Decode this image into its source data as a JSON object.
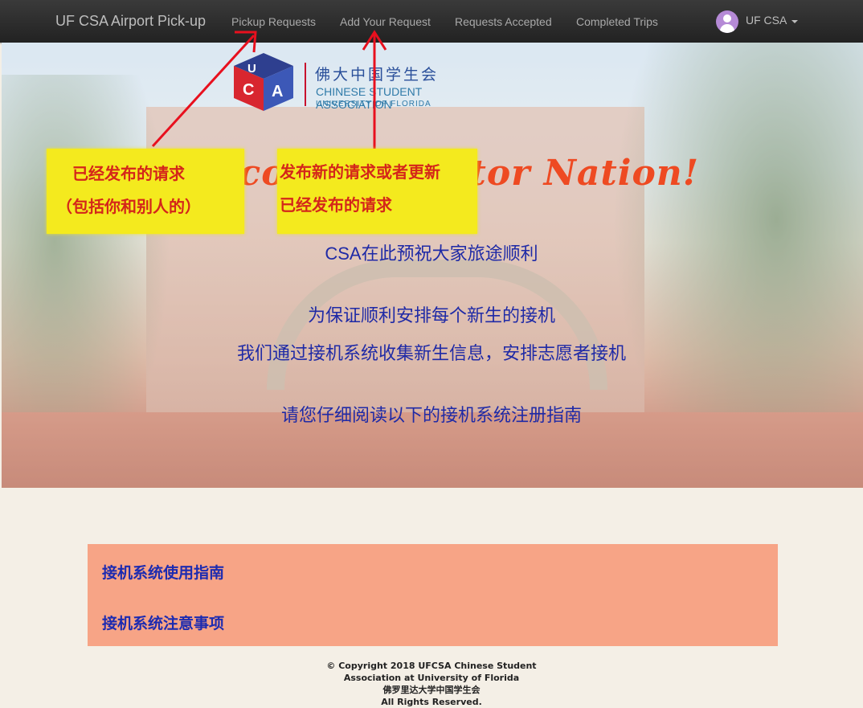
{
  "navbar": {
    "brand": "UF CSA Airport Pick-up",
    "links": [
      "Pickup Requests",
      "Add Your Request",
      "Requests Accepted",
      "Completed Trips"
    ],
    "user": "UF CSA"
  },
  "logo": {
    "chinese": "佛大中国学生会",
    "english": "CHINESE STUDENT ASSOCIATION",
    "sub": "UNIVERSITY OF FLORIDA"
  },
  "hero": {
    "welcome": "Welcome to Gator Nation!",
    "lines": [
      "CSA在此预祝大家旅途顺利",
      "为保证顺利安排每个新生的接机",
      "我们通过接机系统收集新生信息，安排志愿者接机",
      "请您仔细阅读以下的接机系统注册指南"
    ]
  },
  "annotations": {
    "pickup_note": [
      "已经发布的请求",
      "（包括你和别人的）"
    ],
    "add_note": [
      "发布新的请求或者更新",
      "已经发布的请求"
    ],
    "arrow_color": "#e8101e",
    "highlight_color": "#f4ea1e"
  },
  "guide": {
    "links": [
      "接机系统使用指南",
      "接机系统注意事项"
    ]
  },
  "footer": {
    "lines": [
      "© Copyright 2018 UFCSA Chinese Student",
      "Association at University of Florida",
      "佛罗里达大学中国学生会",
      "All Rights Reserved."
    ]
  }
}
